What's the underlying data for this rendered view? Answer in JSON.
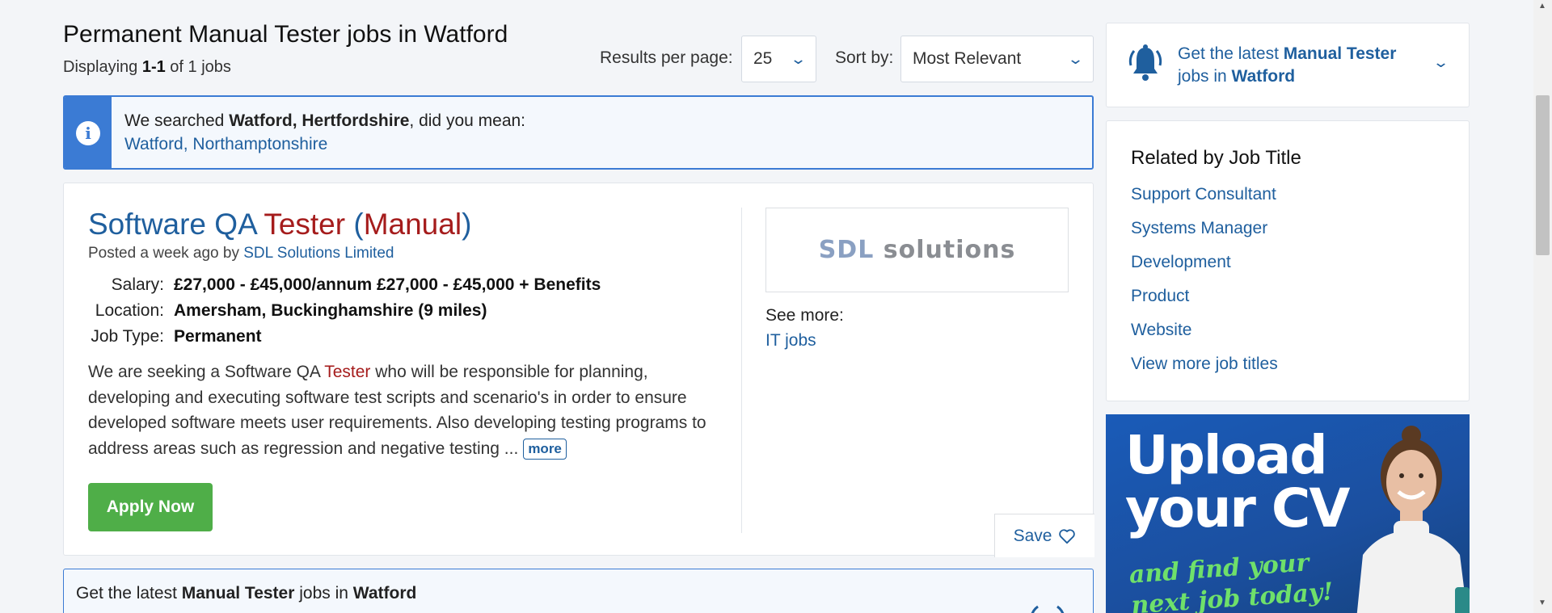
{
  "header": {
    "title": "Permanent Manual Tester jobs in Watford",
    "displaying_prefix": "Displaying ",
    "displaying_range": "1-1",
    "displaying_suffix": " of 1 jobs",
    "results_per_page_label": "Results per page:",
    "results_per_page_value": "25",
    "sort_label": "Sort by:",
    "sort_value": "Most Relevant"
  },
  "info": {
    "text_prefix": "We searched ",
    "searched_location": "Watford, Hertfordshire",
    "text_suffix": ", did you mean:",
    "suggestion_link": "Watford, Northamptonshire"
  },
  "job": {
    "title_part1": "Software QA ",
    "title_highlight1": "Tester",
    "title_part2": " (",
    "title_highlight2": "Manual",
    "title_part3": ")",
    "posted_prefix": "Posted a week ago by ",
    "company": "SDL Solutions Limited",
    "salary_label": "Salary:",
    "salary_value": "£27,000 - £45,000/annum £27,000 - £45,000 + Benefits",
    "location_label": "Location:",
    "location_value": "Amersham, Buckinghamshire (9 miles)",
    "jobtype_label": "Job Type:",
    "jobtype_value": "Permanent",
    "desc_part1": "We are seeking a Software QA ",
    "desc_highlight": "Tester",
    "desc_part2": " who will be responsible for planning, developing and executing software test scripts and scenario's in order to ensure developed software meets user requirements. Also developing testing programs to address areas such as regression and negative testing ...",
    "more_label": "more",
    "apply_label": "Apply Now",
    "logo_text_a": "SDL",
    "logo_text_b": " solutions",
    "see_more_label": "See more:",
    "see_more_link": "IT jobs",
    "save_label": "Save"
  },
  "bottom_alert": {
    "prefix": "Get the latest ",
    "keyword": "Manual Tester",
    "middle": " jobs in ",
    "location": "Watford"
  },
  "sidebar": {
    "alert_prefix": "Get the latest ",
    "alert_keyword": "Manual Tester",
    "alert_middle": " jobs in ",
    "alert_location": "Watford",
    "related_title": "Related by Job Title",
    "related_items": [
      "Support Consultant",
      "Systems Manager",
      "Development",
      "Product",
      "Website",
      "View more job titles"
    ]
  },
  "ad": {
    "headline_line1": "Upload",
    "headline_line2": "your CV",
    "tagline_line1": "and find your",
    "tagline_line2": "next job today!"
  },
  "colors": {
    "link": "#1f5f9e",
    "highlight": "#a51c1c",
    "apply_green": "#4fae48",
    "info_blue": "#3b7bd4"
  }
}
